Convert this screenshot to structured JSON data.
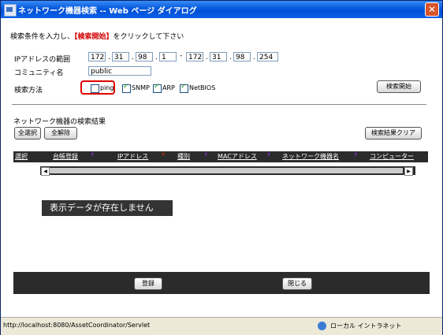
{
  "window": {
    "title": "ネットワーク機器検索 -- Web ページ ダイアログ",
    "close_label": "✕"
  },
  "instruction": {
    "pre": "検索条件を入力し、",
    "highlight": "【検索開始】",
    "post": "をクリックして下さい"
  },
  "ip_range": {
    "label": "IPアドレスの範囲",
    "from": [
      "172",
      "31",
      "98",
      "1"
    ],
    "to": [
      "172",
      "31",
      "98",
      "254"
    ],
    "separator": "-",
    "dot": "."
  },
  "community": {
    "label": "コミュニティ名",
    "value": "public"
  },
  "search_method": {
    "label": "検索方法",
    "options": [
      {
        "label": "ping",
        "checked": false
      },
      {
        "label": "SNMP",
        "checked": true
      },
      {
        "label": "ARP",
        "checked": true
      },
      {
        "label": "NetBIOS",
        "checked": true
      }
    ]
  },
  "buttons": {
    "search_start": "検索開始",
    "select_all": "全選択",
    "deselect_all": "全解除",
    "clear_results": "検索結果クリア",
    "register": "登録",
    "close": "閉じる"
  },
  "results": {
    "title": "ネットワーク機器の検索結果",
    "columns": [
      "選択",
      "台帳登録",
      "IPアドレス",
      "種別",
      "MACアドレス",
      "ネットワーク機器名",
      "コンピューター"
    ],
    "empty_message": "表示データが存在しません",
    "scroll_left": "◀",
    "scroll_right": "▶"
  },
  "statusbar": {
    "url": "http://localhost:8080/AssetCoordinator/Servlet",
    "zone": "ローカル イントラネット"
  },
  "colors": {
    "title_bar": "#0050d8",
    "highlight": "#d00000",
    "annotation": "#e00000",
    "sort_purple": "#9933ff",
    "sort_red": "#ff3300",
    "dark_bar": "#2b2b2b"
  }
}
